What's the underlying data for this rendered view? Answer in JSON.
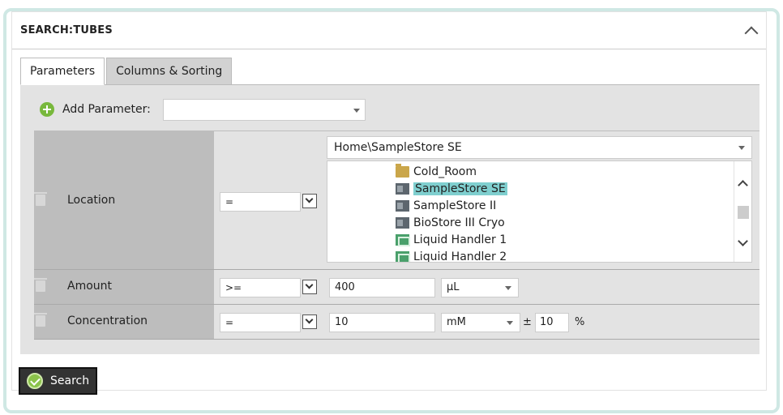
{
  "panel": {
    "title": "SEARCH:TUBES"
  },
  "tabs": [
    {
      "label": "Parameters",
      "active": true
    },
    {
      "label": "Columns & Sorting",
      "active": false
    }
  ],
  "add_parameter": {
    "label": "Add Parameter:",
    "value": ""
  },
  "rows": {
    "location": {
      "label": "Location",
      "operator": "=",
      "path": "Home\\SampleStore SE",
      "tree": [
        {
          "label": "Cold_Room",
          "icon": "folder-icon",
          "selected": false
        },
        {
          "label": "SampleStore SE",
          "icon": "sample-store-icon",
          "selected": true
        },
        {
          "label": "SampleStore II",
          "icon": "sample-store-icon",
          "selected": false
        },
        {
          "label": "BioStore III Cryo",
          "icon": "sample-store-icon",
          "selected": false
        },
        {
          "label": "Liquid Handler 1",
          "icon": "liquid-handler-icon",
          "selected": false
        },
        {
          "label": "Liquid Handler 2",
          "icon": "liquid-handler-icon",
          "selected": false
        }
      ]
    },
    "amount": {
      "label": "Amount",
      "operator": ">=",
      "value": "400",
      "unit": "µL"
    },
    "concentration": {
      "label": "Concentration",
      "operator": "=",
      "value": "10",
      "unit": "mM",
      "plus_minus": "±",
      "tolerance": "10",
      "tolerance_unit": "%"
    }
  },
  "search_button": {
    "label": "Search"
  },
  "colors": {
    "accent": "#78b83c",
    "selection": "#7fcfcf",
    "frame": "#cfe8e4"
  }
}
